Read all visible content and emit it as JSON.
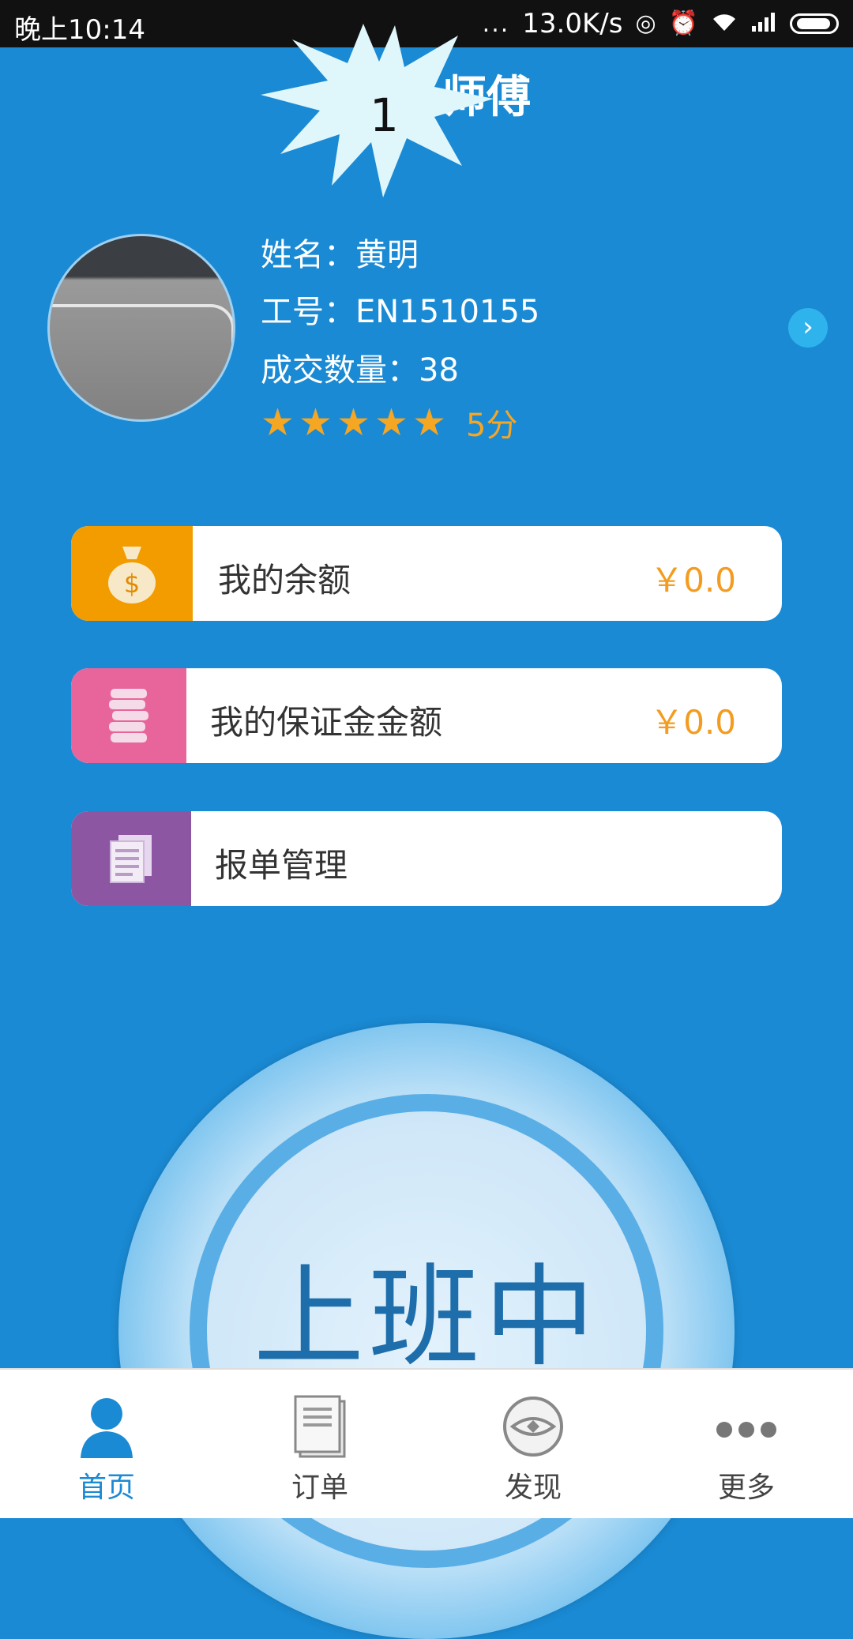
{
  "status_bar": {
    "time": "晚上10:14",
    "network_speed": "13.0K/s",
    "dots": "..."
  },
  "header": {
    "title": "师傅",
    "burst_number": "1"
  },
  "profile": {
    "name_line": "姓名：黄明",
    "id_line": "工号：EN1510155",
    "deals_line": "成交数量：38",
    "rating_stars": 5,
    "score": "5分"
  },
  "cards": [
    {
      "label": "我的余额",
      "value": "￥0.0",
      "icon": "money-bag-icon",
      "color": "#f39c00"
    },
    {
      "label": "我的保证金金额",
      "value": "￥0.0",
      "icon": "coin-stack-icon",
      "color": "#e8659c"
    },
    {
      "label": "报单管理",
      "value": "",
      "icon": "documents-icon",
      "color": "#8c56a3"
    }
  ],
  "work_button": {
    "label": "上班中"
  },
  "bottom_nav": {
    "items": [
      {
        "label": "首页",
        "icon": "person-icon",
        "active": true
      },
      {
        "label": "订单",
        "icon": "order-list-icon",
        "active": false
      },
      {
        "label": "发现",
        "icon": "eye-icon",
        "active": false
      },
      {
        "label": "更多",
        "icon": "more-dots-icon",
        "active": false
      }
    ]
  },
  "colors": {
    "background": "#1a8ad4",
    "accent": "#f5a623",
    "nav_active": "#1a8ad4"
  }
}
